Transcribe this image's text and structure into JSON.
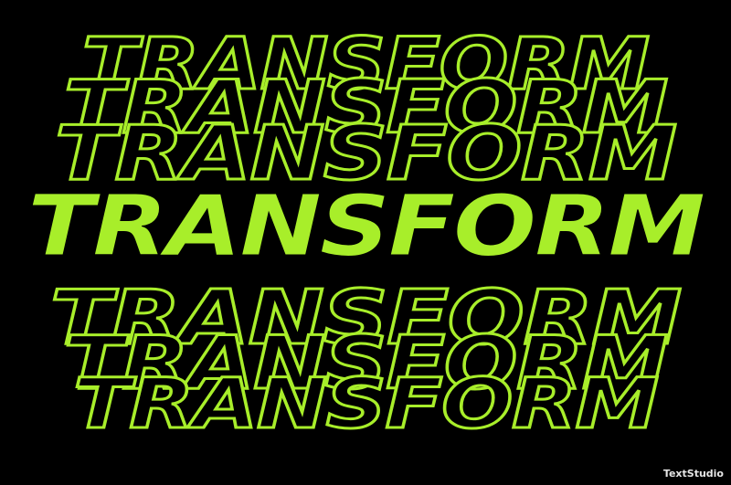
{
  "artwork": {
    "headline": "TRANSFORM",
    "echo_text": "TRANSFORM",
    "colors": {
      "background": "#000000",
      "accent": "#a8ee2a",
      "watermark": "#ffffff"
    }
  },
  "watermark": {
    "label": "TextStudio"
  }
}
